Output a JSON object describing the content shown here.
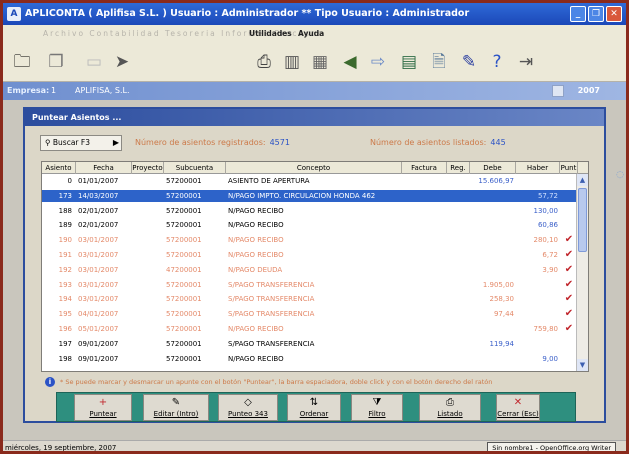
{
  "window": {
    "title": "APLICONTA ( Aplifisa S.L. ) Usuario : Administrador ** Tipo Usuario : Administrador",
    "logo": "A"
  },
  "menubar": {
    "faded_items": "Archivo  Contabilidad  Tesoreria  Informes  Procesos",
    "items": [
      "Utilidades",
      "Ayuda"
    ]
  },
  "toolbar": {
    "icons": [
      "open-folder-icon",
      "copy-icon",
      "document-icon",
      "share-icon",
      "printer-icon",
      "chart-icon",
      "calculator-icon",
      "back-icon",
      "next-icon",
      "keyboard-icon",
      "document2-icon",
      "edit-icon",
      "help-icon",
      "exit-icon"
    ]
  },
  "company_bar": {
    "label": "Empresa:",
    "number": "1",
    "name": "APLIFISA, S.L.",
    "year": "2007"
  },
  "panel": {
    "title": "Puntear Asientos ...",
    "search_button": "Buscar F3",
    "registered_label": "Número de asientos registrados:",
    "registered_value": "4571",
    "listed_label": "Número de asientos listados:",
    "listed_value": "445"
  },
  "grid": {
    "columns": [
      "Asiento",
      "Fecha",
      "Proyecto",
      "Subcuenta",
      "Concepto",
      "Factura",
      "Reg.",
      "Debe",
      "Haber",
      "Punt"
    ],
    "rows": [
      {
        "asiento": "0",
        "fecha": "01/01/2007",
        "proyecto": "",
        "subcuenta": "57200001",
        "concepto": "ASIENTO DE APERTURA",
        "factura": "",
        "reg": "",
        "debe": "15.606,97",
        "haber": "",
        "punt": false,
        "style": "normal"
      },
      {
        "asiento": "173",
        "fecha": "14/03/2007",
        "proyecto": "",
        "subcuenta": "57200001",
        "concepto": "N/PAGO IMPTO. CIRCULACION HONDA 462",
        "factura": "",
        "reg": "",
        "debe": "",
        "haber": "57,72",
        "punt": false,
        "style": "selected"
      },
      {
        "asiento": "188",
        "fecha": "02/01/2007",
        "proyecto": "",
        "subcuenta": "57200001",
        "concepto": "N/PAGO RECIBO",
        "factura": "",
        "reg": "",
        "debe": "",
        "haber": "130,00",
        "punt": false,
        "style": "normal"
      },
      {
        "asiento": "189",
        "fecha": "02/01/2007",
        "proyecto": "",
        "subcuenta": "57200001",
        "concepto": "N/PAGO RECIBO",
        "factura": "",
        "reg": "",
        "debe": "",
        "haber": "60,86",
        "punt": false,
        "style": "normal"
      },
      {
        "asiento": "190",
        "fecha": "03/01/2007",
        "proyecto": "",
        "subcuenta": "57200001",
        "concepto": "N/PAGO RECIBO",
        "factura": "",
        "reg": "",
        "debe": "",
        "haber": "280,10",
        "punt": true,
        "style": "punt"
      },
      {
        "asiento": "191",
        "fecha": "03/01/2007",
        "proyecto": "",
        "subcuenta": "57200001",
        "concepto": "N/PAGO RECIBO",
        "factura": "",
        "reg": "",
        "debe": "",
        "haber": "6,72",
        "punt": true,
        "style": "punt"
      },
      {
        "asiento": "192",
        "fecha": "03/01/2007",
        "proyecto": "",
        "subcuenta": "47200001",
        "concepto": "N/PAGO DEUDA",
        "factura": "",
        "reg": "",
        "debe": "",
        "haber": "3,90",
        "punt": true,
        "style": "punt"
      },
      {
        "asiento": "193",
        "fecha": "03/01/2007",
        "proyecto": "",
        "subcuenta": "57200001",
        "concepto": "S/PAGO TRANSFERENCIA",
        "factura": "",
        "reg": "",
        "debe": "1.905,00",
        "haber": "",
        "punt": true,
        "style": "punt"
      },
      {
        "asiento": "194",
        "fecha": "03/01/2007",
        "proyecto": "",
        "subcuenta": "57200001",
        "concepto": "S/PAGO TRANSFERENCIA",
        "factura": "",
        "reg": "",
        "debe": "258,30",
        "haber": "",
        "punt": true,
        "style": "punt"
      },
      {
        "asiento": "195",
        "fecha": "04/01/2007",
        "proyecto": "",
        "subcuenta": "57200001",
        "concepto": "S/PAGO TRANSFERENCIA",
        "factura": "",
        "reg": "",
        "debe": "97,44",
        "haber": "",
        "punt": true,
        "style": "punt"
      },
      {
        "asiento": "196",
        "fecha": "05/01/2007",
        "proyecto": "",
        "subcuenta": "57200001",
        "concepto": "N/PAGO RECIBO",
        "factura": "",
        "reg": "",
        "debe": "",
        "haber": "759,80",
        "punt": true,
        "style": "punt"
      },
      {
        "asiento": "197",
        "fecha": "09/01/2007",
        "proyecto": "",
        "subcuenta": "57200001",
        "concepto": "S/PAGO TRANSFERENCIA",
        "factura": "",
        "reg": "",
        "debe": "119,94",
        "haber": "",
        "punt": false,
        "style": "normal"
      },
      {
        "asiento": "198",
        "fecha": "09/01/2007",
        "proyecto": "",
        "subcuenta": "57200001",
        "concepto": "N/PAGO RECIBO",
        "factura": "",
        "reg": "",
        "debe": "",
        "haber": "9,00",
        "punt": false,
        "style": "normal"
      }
    ]
  },
  "hint": "* Se puede marcar y desmarcar un apunte con el botón \"Puntear\", la barra espaciadora, doble click y con el botón derecho del ratón",
  "actions": [
    {
      "label": "Puntear",
      "icon": "plus-icon",
      "glyph": "+"
    },
    {
      "label": "Editar (Intro)",
      "icon": "edit-icon",
      "glyph": "✎"
    },
    {
      "label": "Punteo 343",
      "icon": "diamond-icon",
      "glyph": "◇"
    },
    {
      "label": "Ordenar",
      "icon": "sort-icon",
      "glyph": "⇅"
    },
    {
      "label": "Filtro",
      "icon": "filter-icon",
      "glyph": "⧩"
    },
    {
      "label": "Listado",
      "icon": "printer-icon",
      "glyph": "⎙"
    },
    {
      "label": "Cerrar (Esc)",
      "icon": "close-icon",
      "glyph": "✕"
    }
  ],
  "statusbar": {
    "date": "miércoles, 19 septiembre, 2007",
    "task": "Sin nombre1 - OpenOffice.org Writer"
  }
}
